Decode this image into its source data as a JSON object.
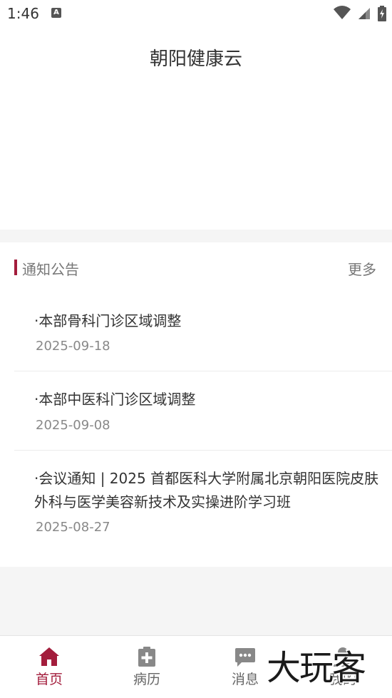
{
  "status_bar": {
    "time": "1:46",
    "a_icon": "A"
  },
  "app": {
    "title": "朝阳健康云"
  },
  "notices": {
    "section_title": "通知公告",
    "more_label": "更多",
    "items": [
      {
        "title": "·本部骨科门诊区域调整",
        "date": "2025-09-18"
      },
      {
        "title": "·本部中医科门诊区域调整",
        "date": "2025-09-08"
      },
      {
        "title": "·会议通知 | 2025 首都医科大学附属北京朝阳医院皮肤外科与医学美容新技术及实操进阶学习班",
        "date": "2025-08-27"
      }
    ]
  },
  "tabbar": {
    "items": [
      {
        "label": "首页",
        "icon": "home-icon",
        "active": true
      },
      {
        "label": "病历",
        "icon": "medical-record-icon",
        "active": false
      },
      {
        "label": "消息",
        "icon": "message-icon",
        "active": false
      },
      {
        "label": "我的",
        "icon": "profile-icon",
        "active": false
      }
    ]
  },
  "watermark": {
    "text": "大玩客"
  },
  "colors": {
    "accent": "#a31d3c",
    "inactive_icon": "#888888"
  }
}
